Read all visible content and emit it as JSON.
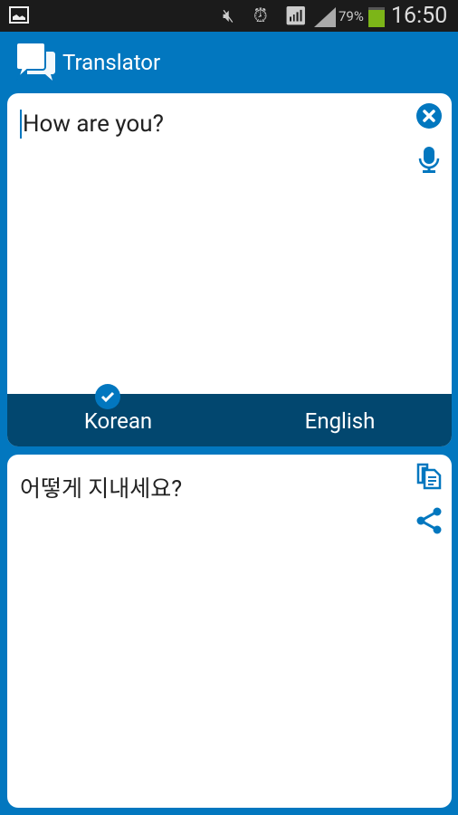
{
  "status_bar": {
    "battery": "79%",
    "time": "16:50",
    "battery_color": "#7cb518",
    "icons": [
      "image-icon",
      "mute-icon",
      "alarm-icon",
      "wifi-icon",
      "signal-icon",
      "battery-icon"
    ]
  },
  "app": {
    "title": "Translator",
    "accent": "#0277bf",
    "lang_bar_color": "#02476f"
  },
  "source": {
    "text": "How are you?",
    "language": "Korean",
    "selected": true
  },
  "target": {
    "text": "어떻게 지내세요?",
    "language": "English"
  }
}
